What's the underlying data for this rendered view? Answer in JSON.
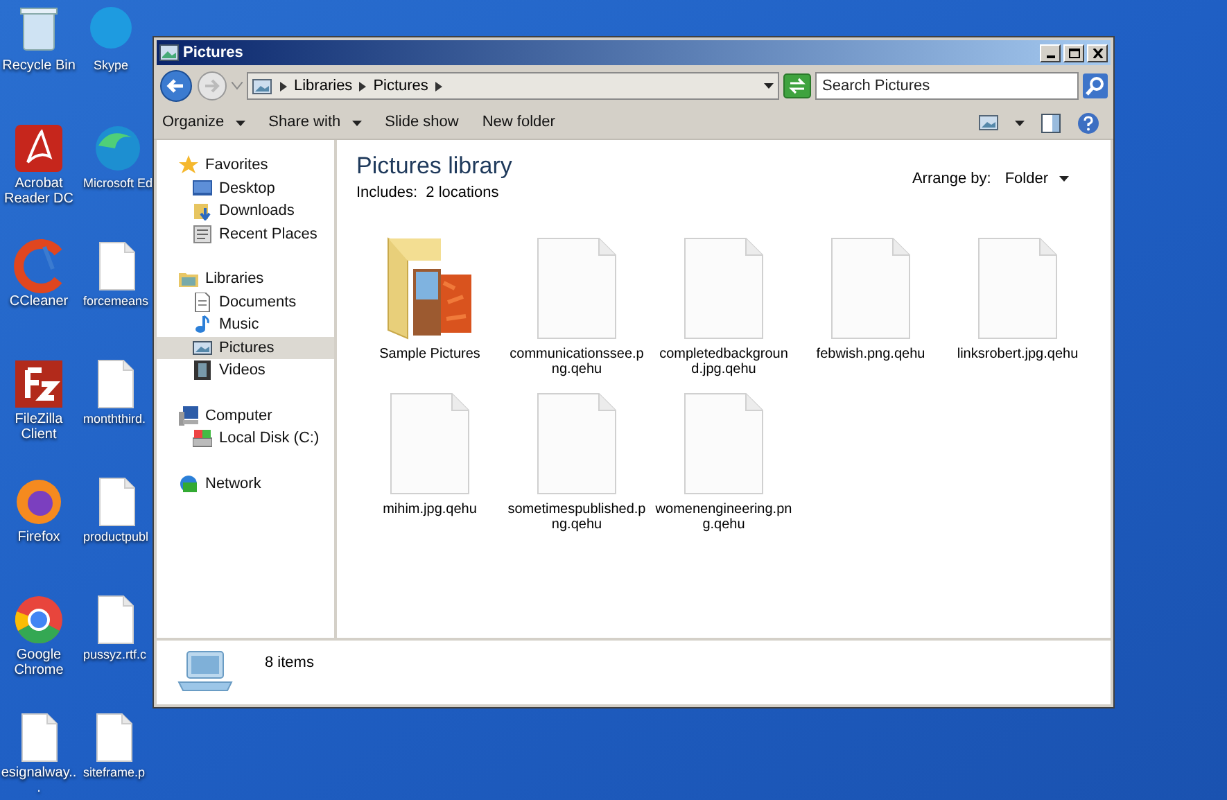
{
  "desktop": {
    "columns": [
      [
        {
          "label": "Recycle Bin",
          "kind": "bin"
        },
        {
          "label": "Acrobat Reader DC",
          "kind": "acrobat"
        },
        {
          "label": "CCleaner",
          "kind": "ccleaner"
        },
        {
          "label": "FileZilla Client",
          "kind": "filezilla"
        },
        {
          "label": "Firefox",
          "kind": "firefox"
        },
        {
          "label": "Google Chrome",
          "kind": "chrome"
        },
        {
          "label": "esignalway...",
          "kind": "file"
        }
      ],
      [
        {
          "label": "Skype",
          "kind": "skype"
        },
        {
          "label": "Microsoft Ed",
          "kind": "edge"
        },
        {
          "label": "forcemeans",
          "kind": "file"
        },
        {
          "label": "monththird.",
          "kind": "file"
        },
        {
          "label": "productpubl",
          "kind": "file"
        },
        {
          "label": "pussyz.rtf.c",
          "kind": "file"
        },
        {
          "label": "siteframe.p",
          "kind": "file"
        }
      ]
    ]
  },
  "window": {
    "title": "Pictures"
  },
  "address": {
    "crumbs": [
      "Libraries",
      "Pictures"
    ]
  },
  "search": {
    "placeholder": "Search Pictures"
  },
  "toolbar": [
    {
      "label": "Organize",
      "dropdown": true
    },
    {
      "label": "Share with",
      "dropdown": true
    },
    {
      "label": "Slide show",
      "dropdown": false
    },
    {
      "label": "New folder",
      "dropdown": false
    }
  ],
  "sidebar": {
    "items": [
      {
        "label": "Favorites",
        "kind": "star",
        "selected": false,
        "children": [
          {
            "label": "Desktop",
            "kind": "desktop",
            "selected": false
          },
          {
            "label": "Downloads",
            "kind": "downloads",
            "selected": false
          },
          {
            "label": "Recent Places",
            "kind": "recent",
            "selected": false
          }
        ]
      },
      {
        "label": "Libraries",
        "kind": "library",
        "selected": false,
        "children": [
          {
            "label": "Documents",
            "kind": "documents",
            "selected": false
          },
          {
            "label": "Music",
            "kind": "music",
            "selected": false
          },
          {
            "label": "Pictures",
            "kind": "pictures",
            "selected": true
          },
          {
            "label": "Videos",
            "kind": "videos",
            "selected": false
          }
        ]
      },
      {
        "label": "Computer",
        "kind": "computer",
        "selected": false,
        "children": [
          {
            "label": "Local Disk (C:)",
            "kind": "disk",
            "selected": false
          }
        ]
      },
      {
        "label": "Network",
        "kind": "network",
        "selected": false
      }
    ]
  },
  "content": {
    "title": "Pictures library",
    "subtitle": "Includes:  2 locations",
    "arrange_label": "Arrange by:",
    "arrange_value": "Folder",
    "items": [
      {
        "name": "Sample Pictures",
        "kind": "folder"
      },
      {
        "name": "communicationssee.png.qehu",
        "kind": "file"
      },
      {
        "name": "completedbackground.jpg.qehu",
        "kind": "file"
      },
      {
        "name": "febwish.png.qehu",
        "kind": "file"
      },
      {
        "name": "linksrobert.jpg.qehu",
        "kind": "file"
      },
      {
        "name": "mihim.jpg.qehu",
        "kind": "file"
      },
      {
        "name": "sometimespublished.png.qehu",
        "kind": "file"
      },
      {
        "name": "womenengineering.png.qehu",
        "kind": "file"
      }
    ]
  },
  "status_bar": {
    "text": "8 items"
  }
}
